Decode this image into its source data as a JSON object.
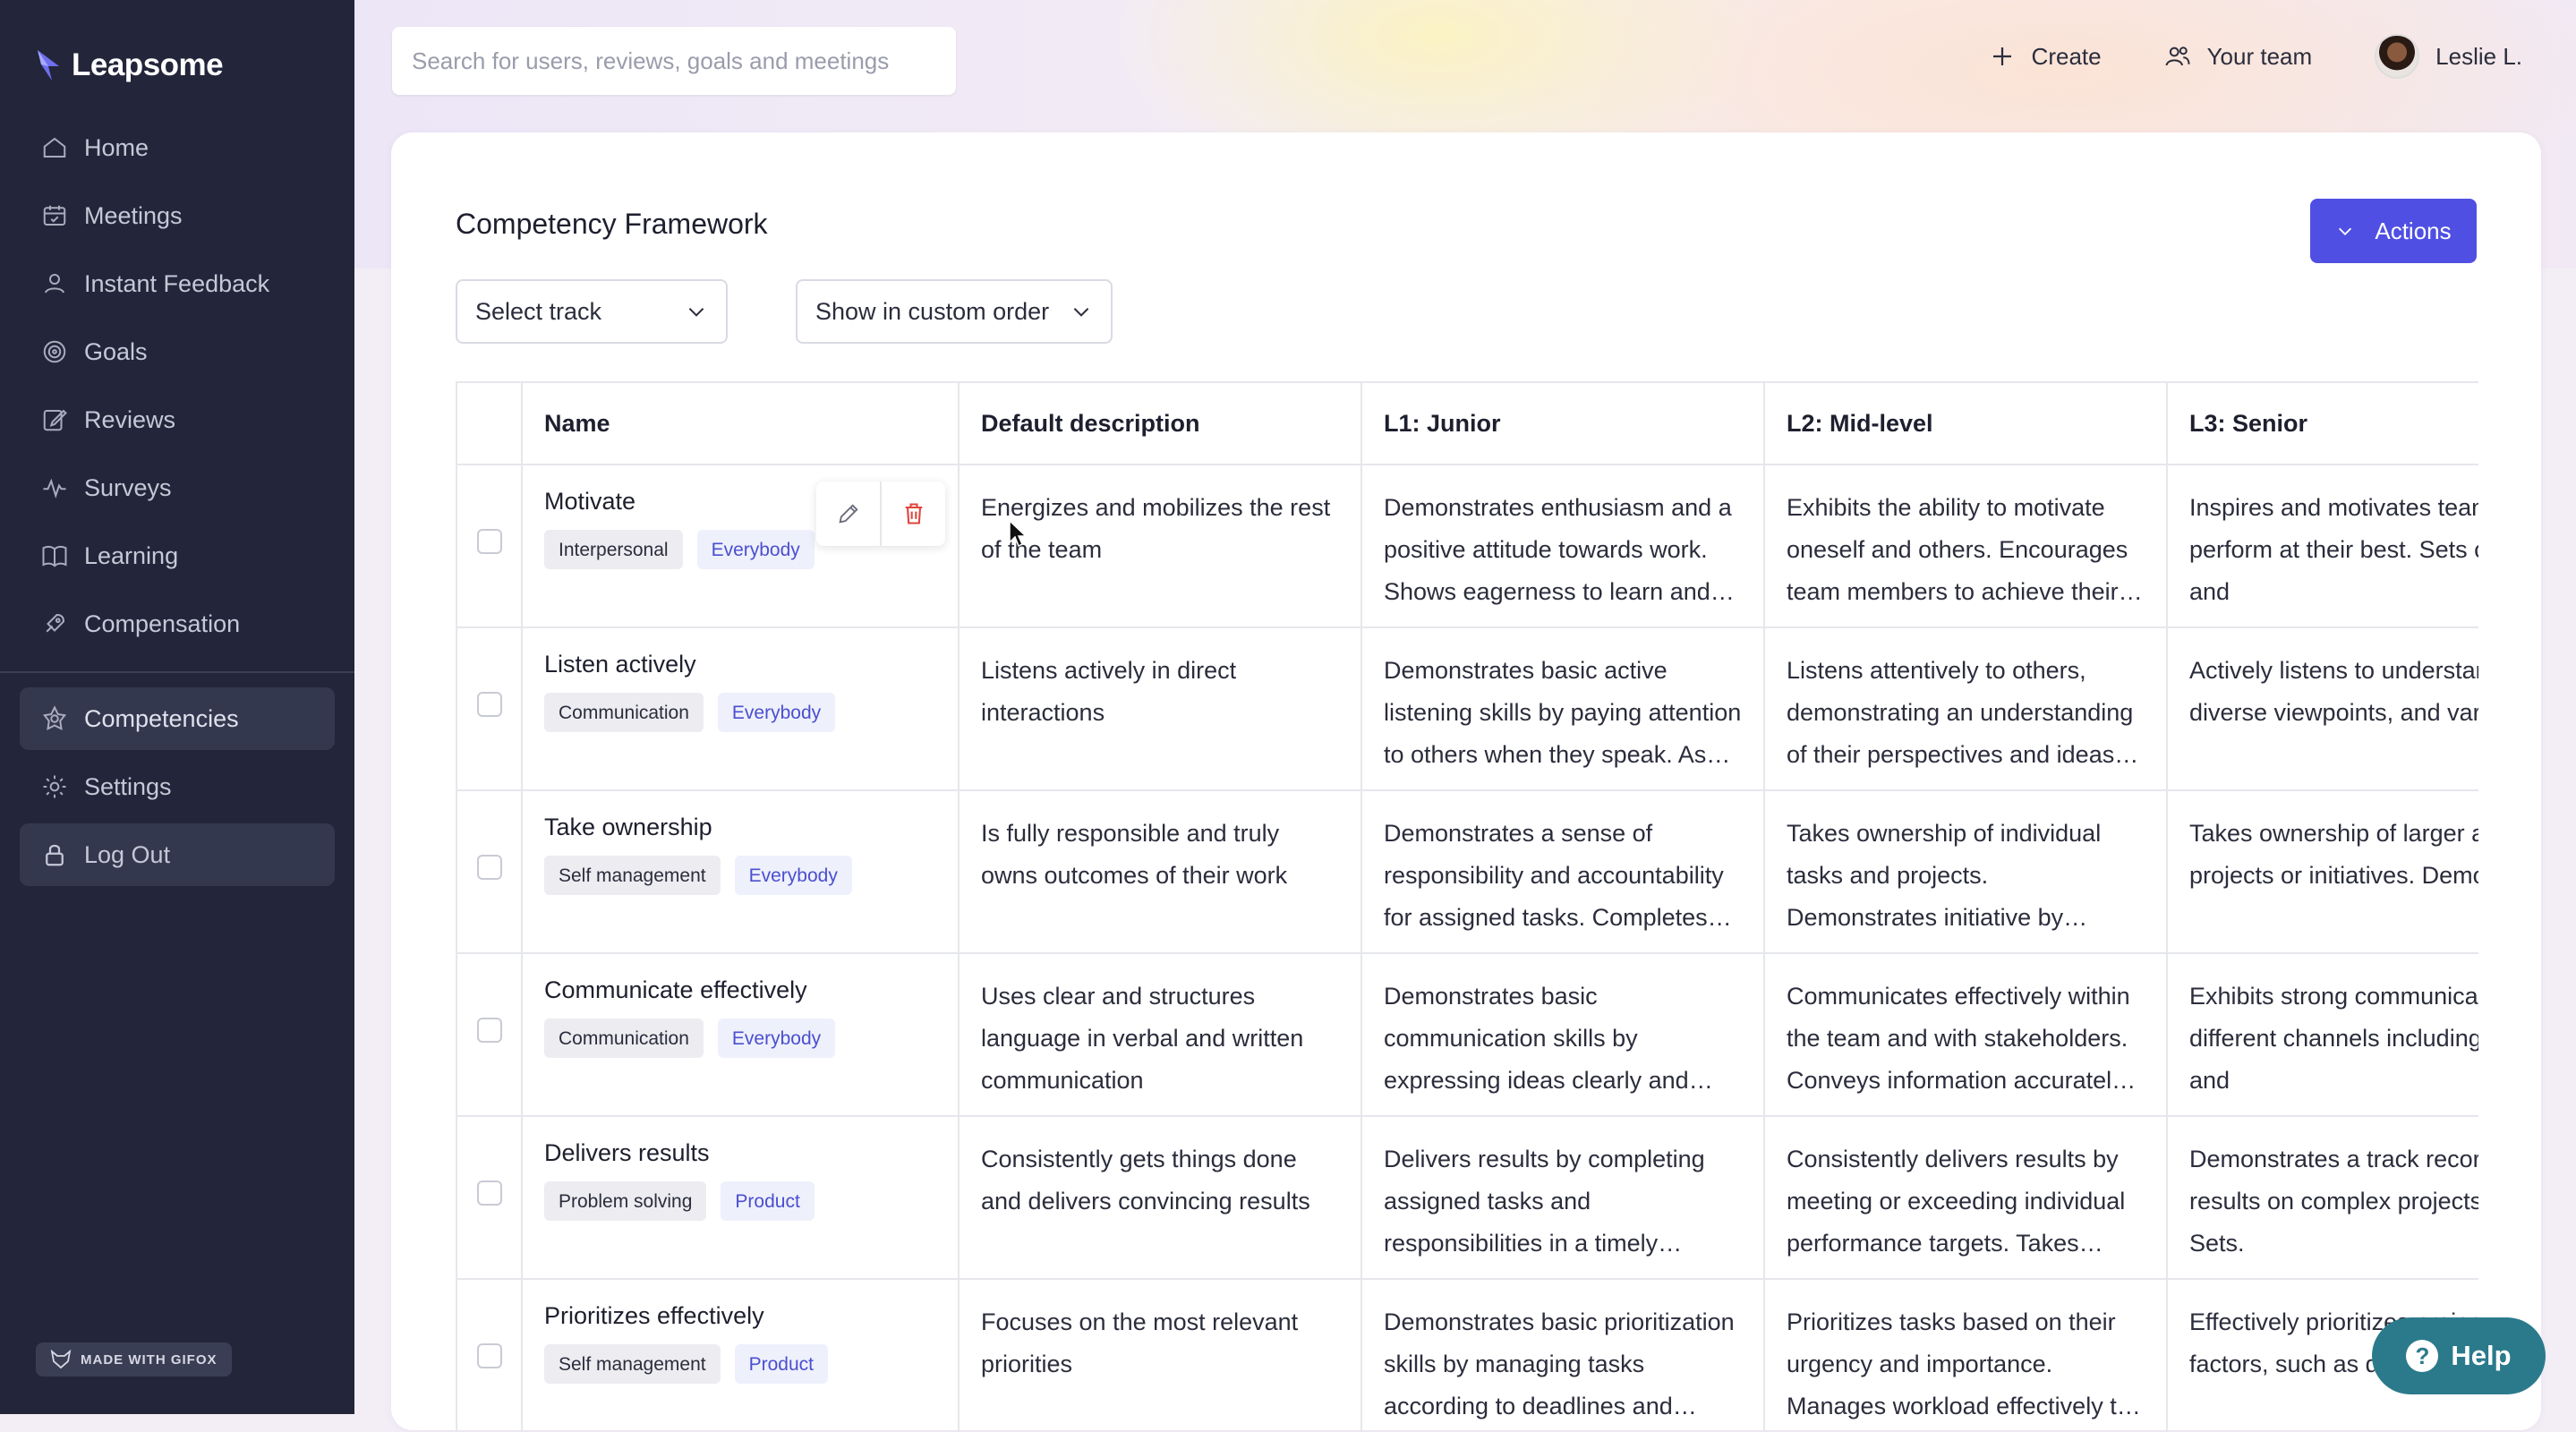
{
  "app": {
    "brand": "Leapsome",
    "search_placeholder": "Search for users, reviews, goals and meetings"
  },
  "header": {
    "create_label": "Create",
    "team_label": "Your team",
    "user_name": "Leslie L."
  },
  "sidebar": {
    "items": [
      {
        "label": "Home",
        "icon": "home-icon"
      },
      {
        "label": "Meetings",
        "icon": "meetings-icon"
      },
      {
        "label": "Instant Feedback",
        "icon": "feedback-icon"
      },
      {
        "label": "Goals",
        "icon": "goals-icon"
      },
      {
        "label": "Reviews",
        "icon": "reviews-icon"
      },
      {
        "label": "Surveys",
        "icon": "surveys-icon"
      },
      {
        "label": "Learning",
        "icon": "learning-icon"
      },
      {
        "label": "Compensation",
        "icon": "compensation-icon"
      }
    ],
    "secondary": [
      {
        "label": "Competencies",
        "icon": "competencies-icon",
        "active": true
      },
      {
        "label": "Settings",
        "icon": "settings-icon"
      },
      {
        "label": "Log Out",
        "icon": "lock-icon"
      }
    ],
    "badge": "MADE WITH GIFOX"
  },
  "main": {
    "title": "Competency Framework",
    "actions_label": "Actions",
    "track_select": "Select track",
    "order_select": "Show in custom order",
    "columns": [
      "Name",
      "Default description",
      "L1: Junior",
      "L2: Mid-level",
      "L3: Senior"
    ],
    "rows": [
      {
        "name": "Motivate",
        "category": "Interpersonal",
        "audience": "Everybody",
        "description": "Energizes and mobilizes the rest of the team",
        "l1": "Demonstrates enthusiasm and a positive attitude towards work. Shows eagerness to learn and grow.",
        "l2": "Exhibits the ability to motivate oneself and others. Encourages team members to achieve their goals.",
        "l3": "Inspires and motivates team members to perform at their best. Sets clear expectations and"
      },
      {
        "name": "Listen actively",
        "category": "Communication",
        "audience": "Everybody",
        "description": "Listens actively in direct interactions",
        "l1": "Demonstrates basic active listening skills by paying attention to others when they speak. Asks questions.",
        "l2": "Listens attentively to others, demonstrating an understanding of their perspectives and ideas. Responds.",
        "l3": "Actively listens to understand complex ideas, diverse viewpoints, and varying opinions"
      },
      {
        "name": "Take ownership",
        "category": "Self management",
        "audience": "Everybody",
        "description": "Is fully responsible and truly owns outcomes of their work",
        "l1": "Demonstrates a sense of responsibility and accountability for assigned tasks. Completes work on time.",
        "l2": "Takes ownership of individual tasks and projects. Demonstrates initiative by identifying and solving issues.",
        "l3": "Takes ownership of larger and more complex projects or initiatives. Demonstrates a."
      },
      {
        "name": "Communicate effectively",
        "category": "Communication",
        "audience": "Everybody",
        "description": "Uses clear and structures language in verbal and written communication",
        "l1": "Demonstrates basic communication skills by expressing ideas clearly and concisely.",
        "l2": "Communicates effectively within the team and with stakeholders. Conveys information accurately, timely.",
        "l3": "Exhibits strong communication skills across different channels including verbal, written, and"
      },
      {
        "name": "Delivers results",
        "category": "Problem solving",
        "audience": "Product",
        "description": "Consistently gets things done and delivers convincing results",
        "l1": "Delivers results by completing assigned tasks and responsibilities in a timely manner.",
        "l2": "Consistently delivers results by meeting or exceeding individual performance targets. Takes initiative.",
        "l3": "Demonstrates a track record of delivering results on complex projects or initiatives. Sets."
      },
      {
        "name": "Prioritizes effectively",
        "category": "Self management",
        "audience": "Product",
        "description": "Focuses on the most relevant priorities",
        "l1": "Demonstrates basic prioritization skills by managing tasks according to deadlines and importance.",
        "l2": "Prioritizes tasks based on their urgency and importance. Manages workload effectively to meet deadlines.",
        "l3": "Effectively prioritizes projects considering factors, such as deadlines"
      }
    ]
  },
  "help_label": "Help",
  "colors": {
    "sidebar": "#23263a",
    "accent": "#4f4fe3",
    "help": "#2b7a8c",
    "tag_audience_text": "#4b4fcf"
  }
}
